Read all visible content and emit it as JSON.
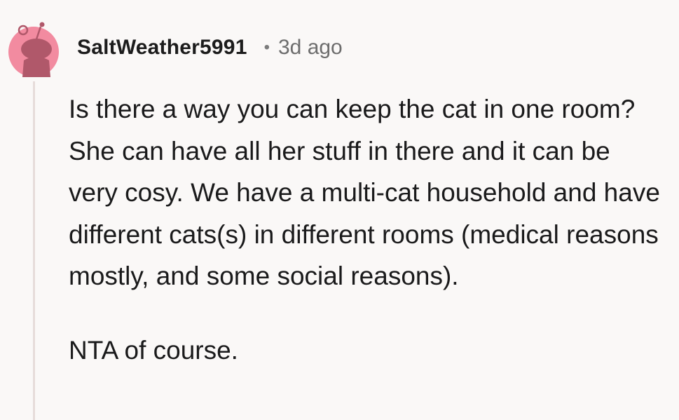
{
  "comment": {
    "author": "SaltWeather5991",
    "separator": "•",
    "time": "3d ago",
    "paragraphs": [
      "Is there a way you can keep the cat in one room? She can have all her stuff in there and it can be very cosy. We have a multi-cat household and have different cats(s) in different rooms (medical reasons mostly, and some social reasons).",
      "NTA of course."
    ]
  },
  "colors": {
    "avatar_bg": "#f28ba0",
    "avatar_fg": "#b0586a",
    "thread_line": "#e6dcda",
    "page_bg": "#faf8f7"
  },
  "icons": {
    "avatar": "reddit-snoo-avatar-icon"
  }
}
